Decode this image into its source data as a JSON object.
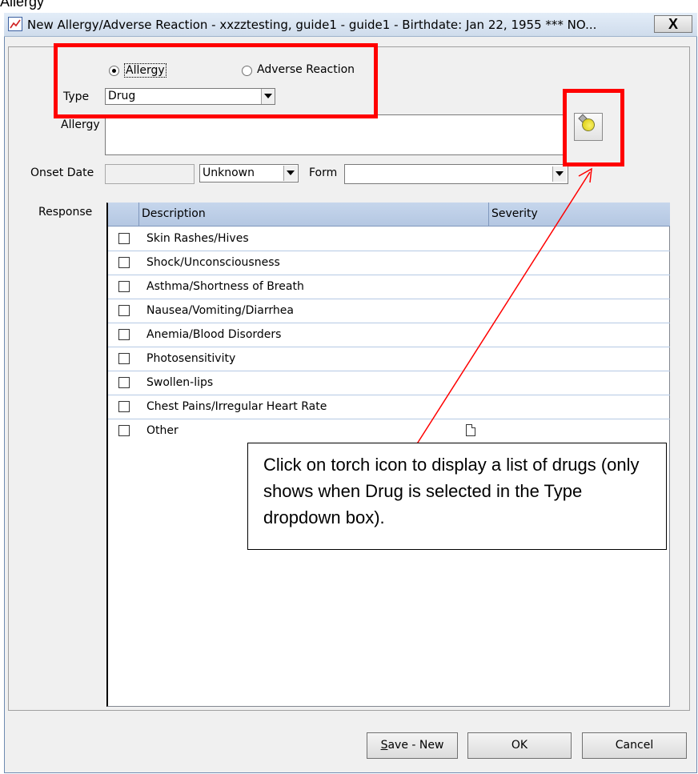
{
  "doc_title": "Allergy",
  "window": {
    "title": "New Allergy/Adverse Reaction - xxzztesting, guide1  - guide1 - Birthdate: Jan 22, 1955 *** NO...",
    "close_label": "X"
  },
  "form": {
    "radio_allergy_label": "Allergy",
    "radio_adverse_label": "Adverse Reaction",
    "selected_radio": "Allergy",
    "type_label": "Type",
    "type_value": "Drug",
    "allergy_label": "Allergy",
    "allergy_value": "",
    "onset_date_label": "Onset Date",
    "onset_date_value": "",
    "onset_precision_value": "Unknown",
    "form_label": "Form",
    "form_value": "",
    "response_label": "Response"
  },
  "response_grid": {
    "columns": [
      "Description",
      "Severity"
    ],
    "rows": [
      {
        "description": "Skin Rashes/Hives",
        "checked": false
      },
      {
        "description": "Shock/Unconsciousness",
        "checked": false
      },
      {
        "description": "Asthma/Shortness of Breath",
        "checked": false
      },
      {
        "description": "Nausea/Vomiting/Diarrhea",
        "checked": false
      },
      {
        "description": "Anemia/Blood Disorders",
        "checked": false
      },
      {
        "description": "Photosensitivity",
        "checked": false
      },
      {
        "description": "Swollen-lips",
        "checked": false
      },
      {
        "description": "Chest Pains/Irregular Heart Rate",
        "checked": false
      },
      {
        "description": "Other",
        "checked": false
      }
    ]
  },
  "buttons": {
    "save_new_mnemonic": "S",
    "save_new_rest": "ave - New",
    "ok": "OK",
    "cancel": "Cancel"
  },
  "annotation": {
    "callout_text": "Click on torch icon to display a list of drugs (only shows when Drug is selected in the Type dropdown box).",
    "highlight_color": "#ff0000"
  },
  "icons": {
    "app": "chart-icon",
    "torch": "torch-icon",
    "note": "note-icon"
  }
}
